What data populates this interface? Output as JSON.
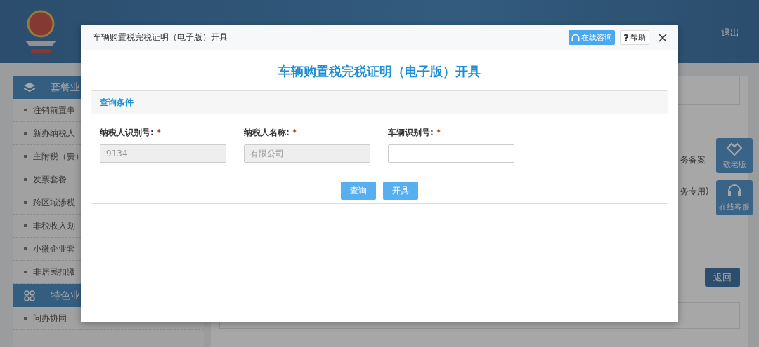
{
  "header": {
    "logout": "退出"
  },
  "sidebar": {
    "sections": [
      {
        "title": "套餐业",
        "items": [
          "注销前置事",
          "新办纳税人",
          "主附税（费）",
          "发票套餐",
          "跨区域涉税",
          "非税收入划",
          "小微企业套",
          "非居民扣缴"
        ]
      },
      {
        "title": "特色业",
        "items": [
          "问办协同"
        ]
      }
    ]
  },
  "content": {
    "lines": [
      "务备案",
      "务专用)"
    ],
    "back_button": "返回"
  },
  "float_buttons": [
    {
      "kind": "elder",
      "label": "敬老版"
    },
    {
      "kind": "service",
      "label": "在线客服"
    }
  ],
  "dialog": {
    "title": "车辆购置税完税证明（电子版）开具",
    "consult_button": "在线咨询",
    "help_icon": "?",
    "help_button": "帮助",
    "heading": "车辆购置税完税证明（电子版）开具",
    "panel": {
      "title": "查询条件",
      "fields": [
        {
          "label": "纳税人识别号:",
          "required_mark": "*",
          "value": "9134",
          "disabled": true
        },
        {
          "label": "纳税人名称:",
          "required_mark": "*",
          "value": "有限公司",
          "disabled": true
        },
        {
          "label": "车辆识别号:",
          "required_mark": "*",
          "disabled": false
        }
      ],
      "buttons": [
        "查询",
        "开具"
      ]
    }
  }
}
